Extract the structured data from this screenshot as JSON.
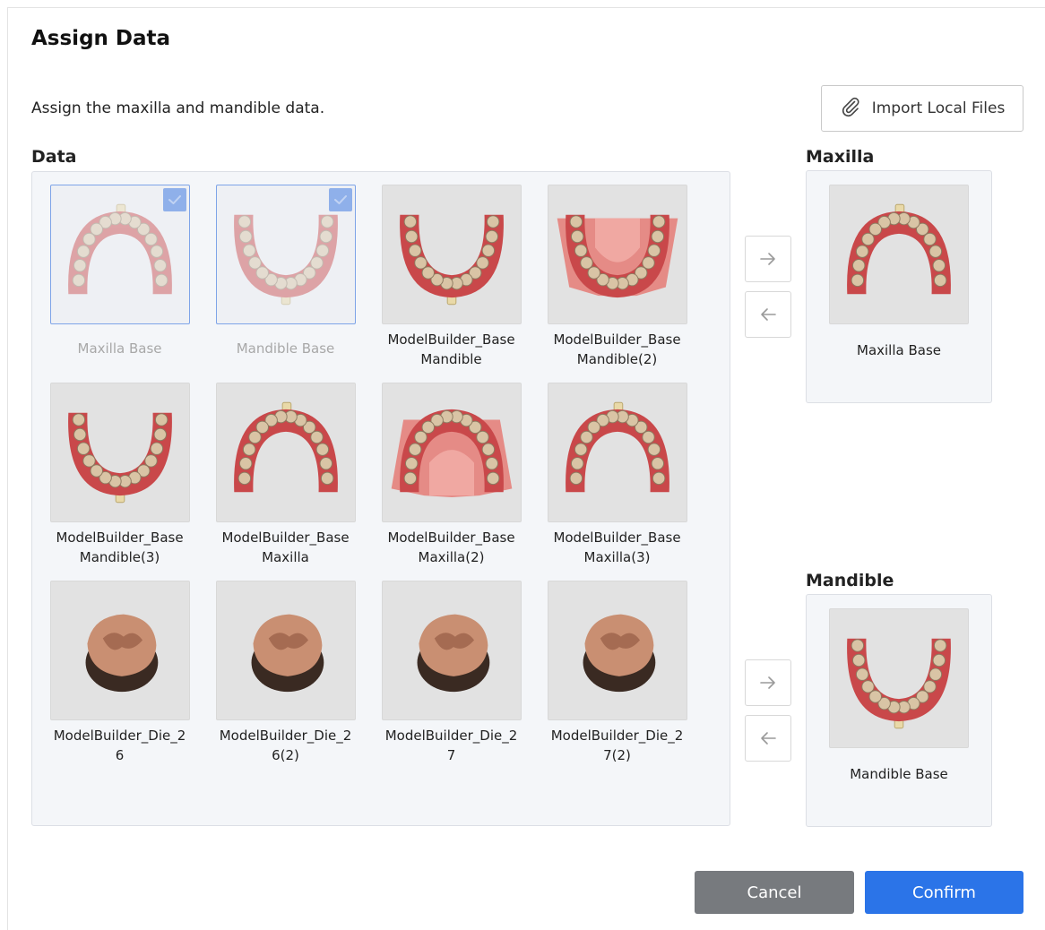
{
  "dialog": {
    "title": "Assign Data",
    "description": "Assign the maxilla and mandible data.",
    "import_label": "Import Local Files",
    "import_icon": "paperclip-icon"
  },
  "sections": {
    "data": "Data",
    "maxilla": "Maxilla",
    "mandible": "Mandible"
  },
  "items": [
    {
      "label": "Maxilla Base",
      "shape": "upper",
      "selected": true
    },
    {
      "label": "Mandible Base",
      "shape": "lower",
      "selected": true
    },
    {
      "label": "ModelBuilder_Base\nMandible",
      "shape": "lower",
      "selected": false
    },
    {
      "label": "ModelBuilder_Base\nMandible(2)",
      "shape": "lower-base",
      "selected": false
    },
    {
      "label": "ModelBuilder_Base\nMandible(3)",
      "shape": "lower",
      "selected": false
    },
    {
      "label": "ModelBuilder_Base\nMaxilla",
      "shape": "upper",
      "selected": false
    },
    {
      "label": "ModelBuilder_Base\nMaxilla(2)",
      "shape": "upper-base",
      "selected": false
    },
    {
      "label": "ModelBuilder_Base\nMaxilla(3)",
      "shape": "upper",
      "selected": false
    },
    {
      "label": "ModelBuilder_Die_2\n6",
      "shape": "die",
      "selected": false
    },
    {
      "label": "ModelBuilder_Die_2\n6(2)",
      "shape": "die",
      "selected": false
    },
    {
      "label": "ModelBuilder_Die_2\n7",
      "shape": "die",
      "selected": false
    },
    {
      "label": "ModelBuilder_Die_2\n7(2)",
      "shape": "die",
      "selected": false
    }
  ],
  "maxilla_slot": {
    "label": "Maxilla Base"
  },
  "mandible_slot": {
    "label": "Mandible Base"
  },
  "buttons": {
    "cancel": "Cancel",
    "confirm": "Confirm"
  },
  "colors": {
    "accent": "#2b74e8",
    "cancel": "#777a7e",
    "gum": "#c9484a",
    "tooth": "#d9c4a5"
  }
}
